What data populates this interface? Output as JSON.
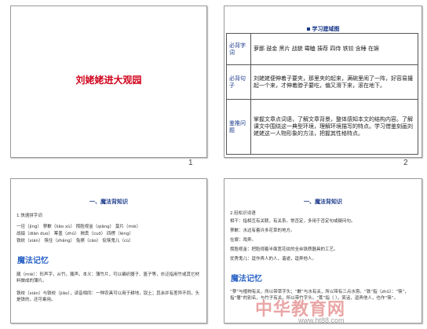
{
  "slides": [
    {
      "title": "刘姥姥进大观园",
      "num": "1"
    },
    {
      "title": "学习建域图",
      "num": "2",
      "rows": [
        {
          "head": "必背字词",
          "body": "萝鄙 鼓金 黑片 战貌 霉瞌 揍荐 四侍 铁铰 含睡 在娱"
        },
        {
          "head": "必背句子",
          "body": "刘姥姥便伸着子要夹，那里夹的起来，满碗里闹了一阵，好容易撮起一个来，才伸着脖子要吃，偏又滑下来，滚在地下。"
        },
        {
          "head": "鉴推问题",
          "body": "掌握文章点词语，了解文章背景，整体感知本文的结构内容。了解课文中围绕这一典型环境，理解环境描写的特点。学习借鉴刻画刘姥姥这一人物形象的方法，把握其性格特点。"
        }
      ]
    },
    {
      "title": "一、魔法背知识",
      "num": "",
      "sub": "1.快速拼字词",
      "lines": [
        "一径（jìng） 蓼歉（liǎo xù） 攒脸视金（qiāng） 莫片（miè）",
        "战掇（diān duo） 筹盖（zhǔ） 揭丢（cuō） 四楞（lèng）",
        "铁絞（xián） 筷住（zhǎng） 兔擦（cāo） 侃筷鬼儿（cù）"
      ],
      "magic": "魔法记忆",
      "para1": "箴（miè）：形声字，从竹，蔑声。本义：薄竹片，可以编织器子、篮子等，亦泛指用竹或其它材料做成的薄片。",
      "para2": "铁绞（xián）与铁绞（jiǎo），读音相同：一种农具可以用于耕地，钗土；其余并有差异不同，头是铁的，还可乘用。"
    },
    {
      "title": "一、魔法背知识",
      "num": "",
      "sub": "2.轻松识词语",
      "lines": [
        "相干：指相互有关联，有关系。常否定，多用于否定句或疑问句。",
        "蓼歉：水边有着许多花草的地方。",
        "在娱：戏弄。",
        "攒脸视金：把脸视着半面宽花纹的全丝铁质器具的工艺。",
        "优秀鬼儿：逗作弄人的人，谐谑，逗弄他人。"
      ],
      "magic": "魔法记忆",
      "para1": "“蓼”与植物有关，所以带草字头；“歉”与水有关，所以带有三点水旁。“铁”指（zhǔ）：“筷”，指“箸”的别名，与竹子有关，所以带竹字头。“蕉”指（ ），笑话，逗弄他人，也作“筷”。"
    }
  ],
  "watermark": {
    "main": "中华教育网",
    "url": "www.ht88.com"
  }
}
